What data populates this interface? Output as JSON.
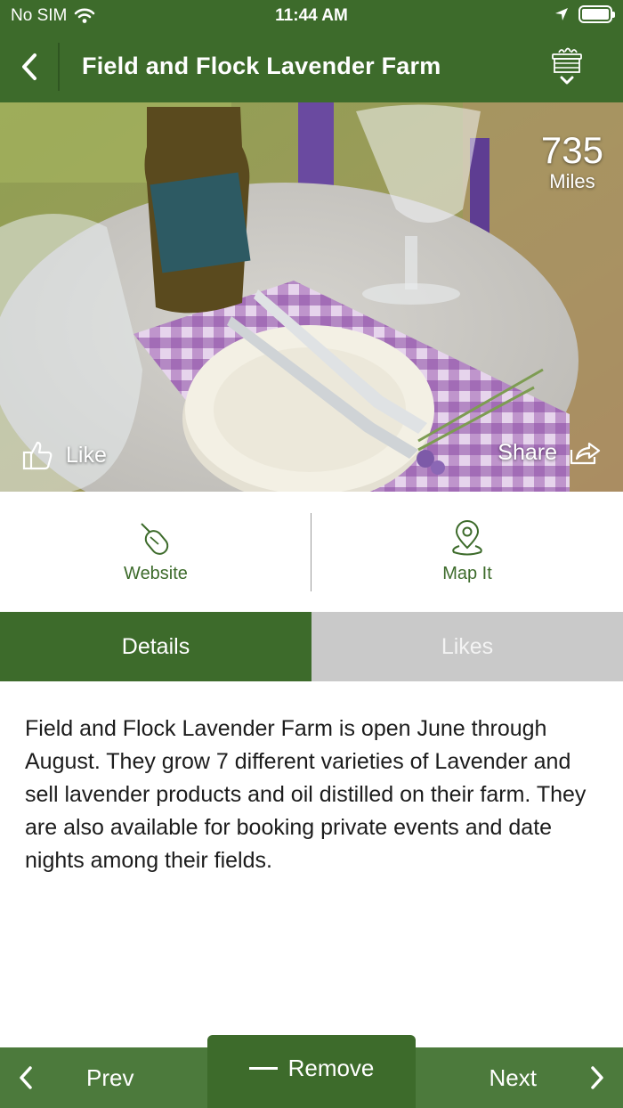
{
  "status_bar": {
    "carrier": "No SIM",
    "time": "11:44 AM"
  },
  "nav": {
    "title": "Field and Flock Lavender Farm"
  },
  "hero": {
    "distance_value": "735",
    "distance_unit": "Miles",
    "like_label": "Like",
    "share_label": "Share"
  },
  "actions": {
    "website_label": "Website",
    "map_label": "Map It"
  },
  "tabs": {
    "details_label": "Details",
    "likes_label": "Likes"
  },
  "details": {
    "text": "Field and Flock Lavender Farm is open June through August. They grow 7 different varieties of Lavender and sell lavender products and oil distilled on their farm. They are also available for booking private events and date nights among their fields."
  },
  "bottom": {
    "prev_label": "Prev",
    "remove_label": "Remove",
    "next_label": "Next"
  },
  "colors": {
    "brand_green": "#3d6b2b",
    "bar_green": "#4c7a3c",
    "inactive_tab": "#c9c9c9"
  }
}
